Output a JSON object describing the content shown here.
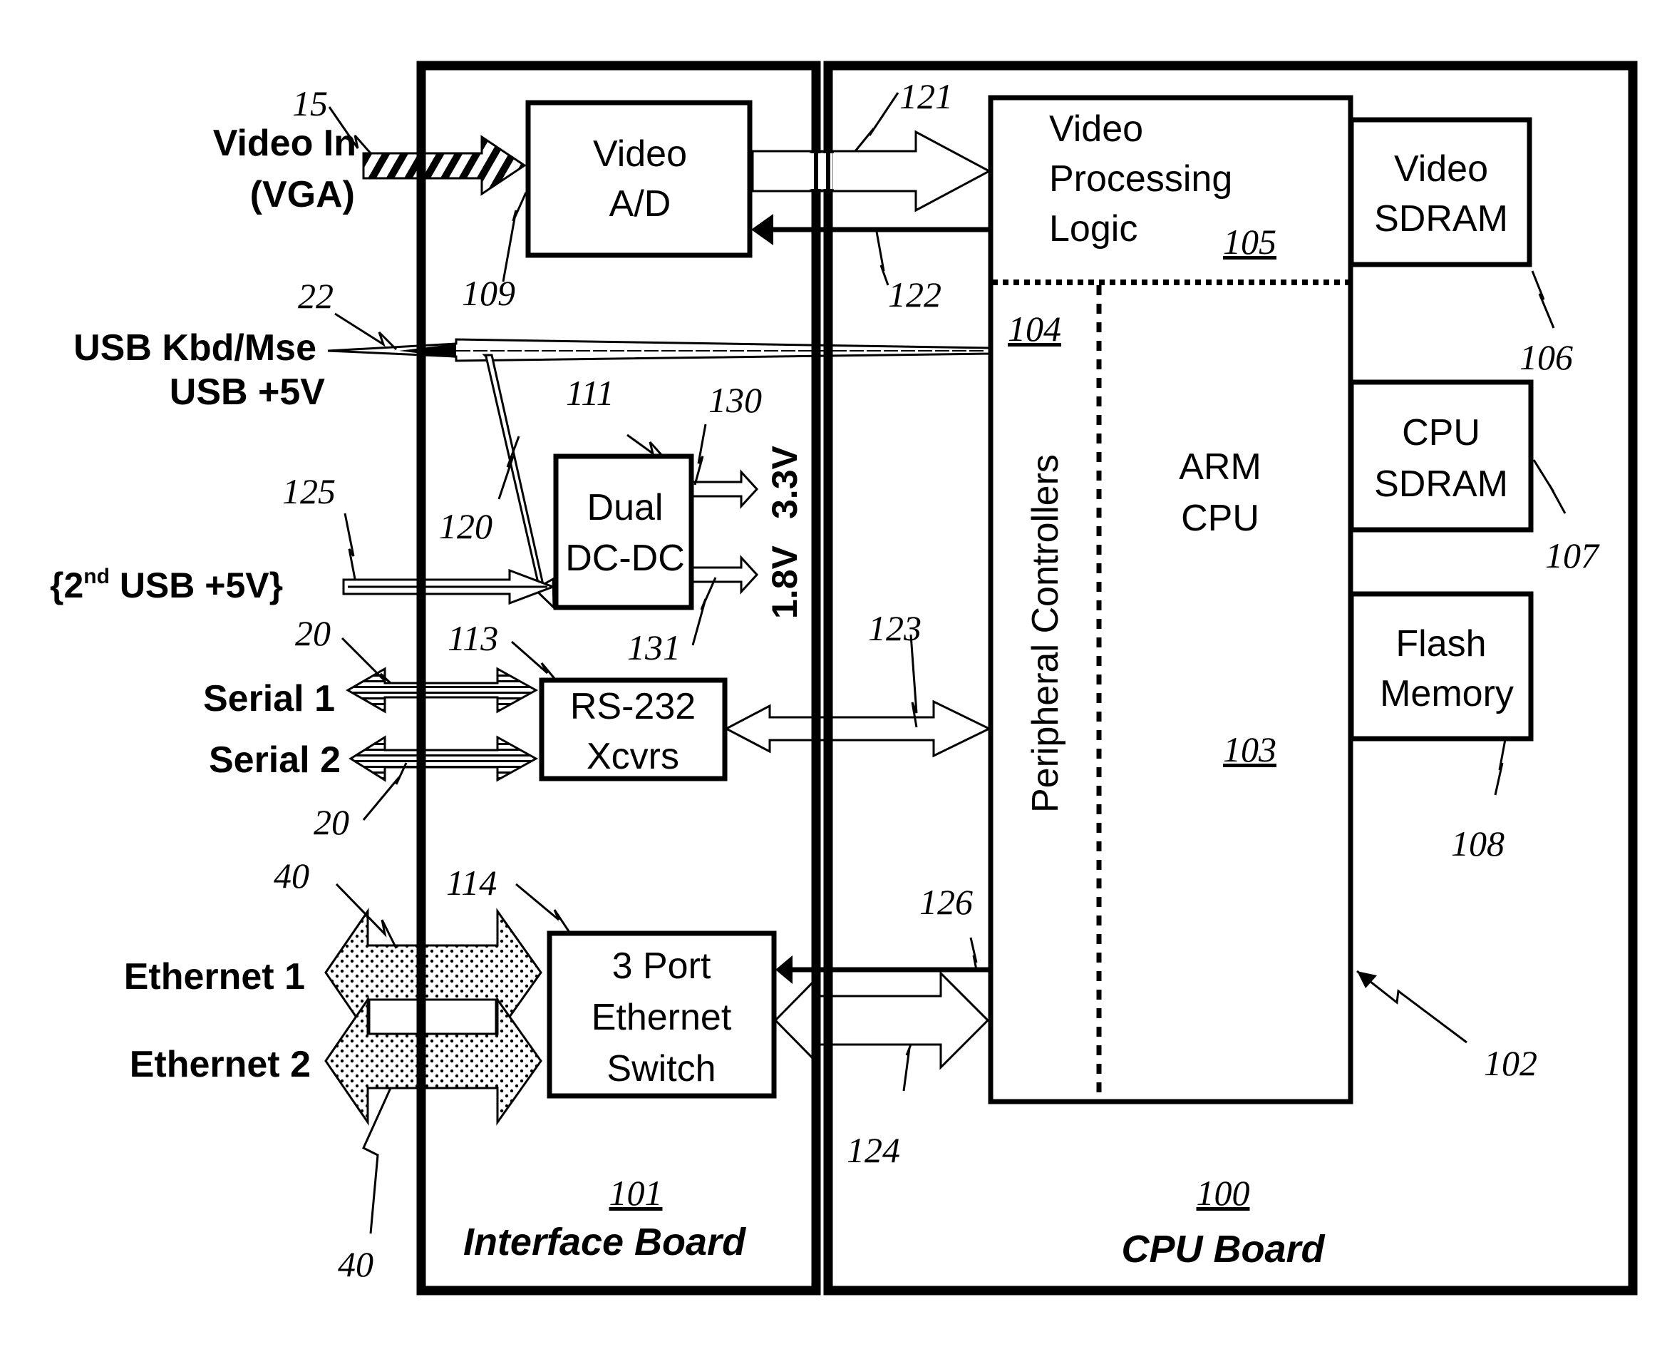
{
  "boards": {
    "interface": {
      "ref": "101",
      "title": "Interface Board"
    },
    "cpu": {
      "ref": "100",
      "title": "CPU Board"
    }
  },
  "external_ports": {
    "video_in": {
      "line1": "Video In",
      "line2": "(VGA)",
      "ref": "15"
    },
    "usb": {
      "line1": "USB Kbd/Mse",
      "line2": "USB +5V",
      "ref": "22"
    },
    "usb2": {
      "prefix": "{2",
      "sup": "nd",
      "suffix": " USB +5V}",
      "ref": "125"
    },
    "serial1": {
      "label": "Serial 1",
      "ref": "20"
    },
    "serial2": {
      "label": "Serial 2",
      "ref": "20"
    },
    "ethernet1": {
      "label": "Ethernet 1",
      "ref": "40"
    },
    "ethernet2": {
      "label": "Ethernet 2",
      "ref": "40"
    }
  },
  "blocks": {
    "video_ad": {
      "line1": "Video",
      "line2": "A/D",
      "ref": "109"
    },
    "dcdc": {
      "line1": "Dual",
      "line2": "DC-DC",
      "ref": "111"
    },
    "rs232": {
      "line1": "RS-232",
      "line2": "Xcvrs",
      "ref": "113"
    },
    "eth_switch": {
      "line1": "3 Port",
      "line2": "Ethernet",
      "line3": "Switch",
      "ref": "114"
    },
    "video_proc": {
      "line1": "Video",
      "line2": "Processing",
      "line3": "Logic",
      "ref": "105"
    },
    "periph": {
      "label": "Peripheral Controllers",
      "ref": "104"
    },
    "arm": {
      "line1": "ARM",
      "line2": "CPU",
      "ref": "103"
    },
    "soc": {
      "ref": "102"
    },
    "video_sdram": {
      "line1": "Video",
      "line2": "SDRAM",
      "ref": "106"
    },
    "cpu_sdram": {
      "line1": "CPU",
      "line2": "SDRAM",
      "ref": "107"
    },
    "flash": {
      "line1": "Flash",
      "line2": "Memory",
      "ref": "108"
    }
  },
  "voltages": {
    "v18": "1.8V",
    "v33": "3.3V"
  },
  "connections": {
    "video_bus_in": "121",
    "video_ctrl": "122",
    "usb_power": "120",
    "out_33": "130",
    "out_18": "131",
    "serial_bus": "123",
    "eth_bus": "124",
    "eth_ctrl": "126"
  }
}
